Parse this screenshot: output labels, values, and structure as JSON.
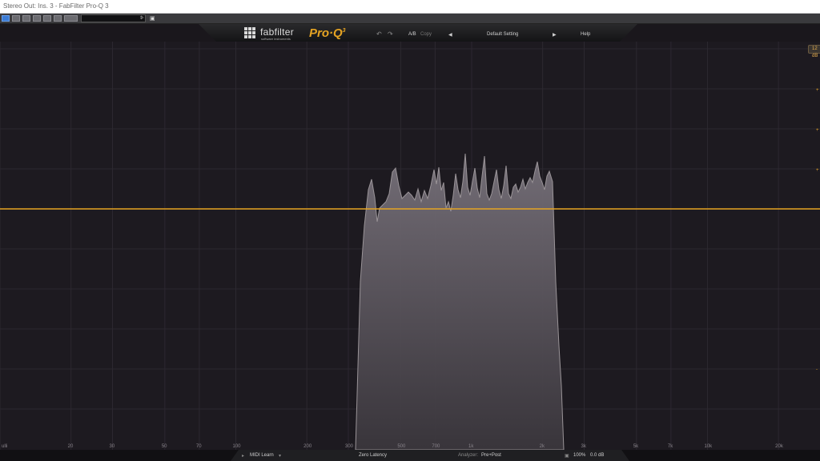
{
  "window": {
    "title": "Stereo Out: Ins. 3 - FabFilter Pro-Q 3"
  },
  "host_toolbar": {
    "buttons": [
      "power",
      "bypass",
      "compare",
      "settings",
      "io",
      "routing"
    ],
    "preset_value": ""
  },
  "plugin_header": {
    "brand": "fabfilter",
    "brand_sub": "software instruments",
    "product": "Pro·Q",
    "product_version": "3",
    "undo_label": "↶",
    "redo_label": "↷",
    "ab_label": "A/B",
    "copy_label": "Copy",
    "prev_label": "◀",
    "preset_name": "Default Setting",
    "next_label": "▶",
    "help_label": "Help"
  },
  "graph": {
    "scale_badge": "12 dB",
    "freq_ticks": [
      {
        "label": "ulli",
        "hz": 10
      },
      {
        "label": "20",
        "hz": 20
      },
      {
        "label": "30",
        "hz": 30
      },
      {
        "label": "50",
        "hz": 50
      },
      {
        "label": "70",
        "hz": 70
      },
      {
        "label": "100",
        "hz": 100
      },
      {
        "label": "200",
        "hz": 200
      },
      {
        "label": "300",
        "hz": 300
      },
      {
        "label": "500",
        "hz": 500
      },
      {
        "label": "700",
        "hz": 700
      },
      {
        "label": "1k",
        "hz": 1000
      },
      {
        "label": "2k",
        "hz": 2000
      },
      {
        "label": "3k",
        "hz": 3000
      },
      {
        "label": "5k",
        "hz": 5000
      },
      {
        "label": "7k",
        "hz": 7000
      },
      {
        "label": "10k",
        "hz": 10000
      },
      {
        "label": "20k",
        "hz": 20000
      }
    ],
    "eq_curve_color": "#e6a423",
    "analyzer_fill": "#6a6468"
  },
  "bottom_bar": {
    "midi_learn": "MIDI Learn",
    "latency": "Zero Latency",
    "analyzer_label": "Analyzer:",
    "analyzer_value": "Pre+Post",
    "zoom": "100%",
    "gain": "0.0 dB"
  }
}
